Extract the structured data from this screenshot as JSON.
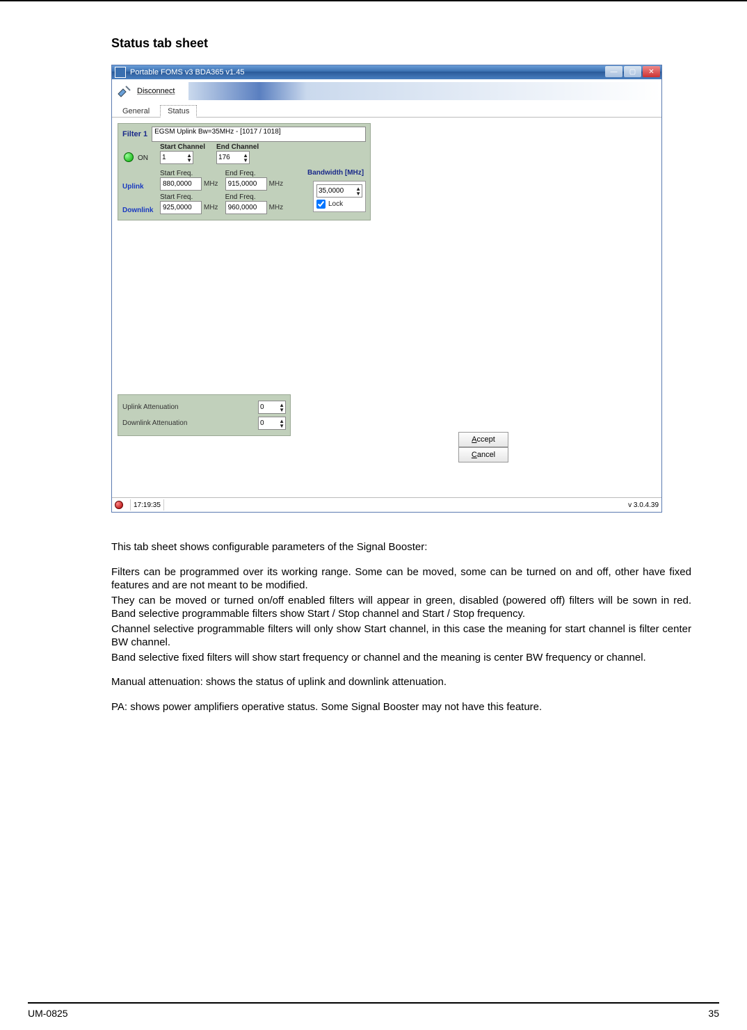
{
  "doc": {
    "heading": "Status tab sheet",
    "footer_left": "UM-0825",
    "footer_right": "35",
    "paragraphs": {
      "p1": "This tab sheet shows configurable parameters of the Signal Booster:",
      "p2": "Filters can be programmed over its working range.  Some can be moved, some can be turned on and off, other have fixed features and are not meant to be modified.",
      "p3": "They can be moved or turned on/off enabled filters will appear in green, disabled (powered off) filters will be sown in red. Band selective programmable filters show Start / Stop channel and Start / Stop frequency.",
      "p4": "Channel selective programmable filters will only show Start channel, in this case the meaning for start channel is filter center BW channel.",
      "p5": "Band selective fixed filters will show start frequency or channel and the meaning is center BW frequency or channel.",
      "p6": "Manual attenuation: shows the status of uplink and downlink attenuation.",
      "p7": "PA: shows power amplifiers operative status. Some Signal Booster may not have this feature."
    }
  },
  "app": {
    "title": "Portable FOMS v3   BDA365 v1.45",
    "toolbar": {
      "disconnect": "Disconnect"
    },
    "tabs": {
      "general": "General",
      "status": "Status"
    },
    "filter": {
      "label": "Filter 1",
      "dropdown": "EGSM Uplink Bw=35MHz - [1017 / 1018]",
      "on_label": "ON",
      "start_channel_label": "Start Channel",
      "start_channel": "1",
      "end_channel_label": "End Channel",
      "end_channel": "176",
      "uplink_label": "Uplink",
      "downlink_label": "Downlink",
      "start_freq_label": "Start Freq.",
      "end_freq_label": "End Freq.",
      "uplink_start_freq": "880,0000",
      "uplink_end_freq": "915,0000",
      "downlink_start_freq": "925,0000",
      "downlink_end_freq": "960,0000",
      "mhz": "MHz",
      "bandwidth_label": "Bandwidth [MHz]",
      "bandwidth_value": "35,0000",
      "lock_label": "Lock"
    },
    "attenuation": {
      "uplink_label": "Uplink Attenuation",
      "uplink_value": "0",
      "downlink_label": "Downlink Attenuation",
      "downlink_value": "0"
    },
    "buttons": {
      "accept": "Accept",
      "cancel": "Cancel"
    },
    "statusbar": {
      "time": "17:19:35",
      "version": "v 3.0.4.39"
    }
  }
}
